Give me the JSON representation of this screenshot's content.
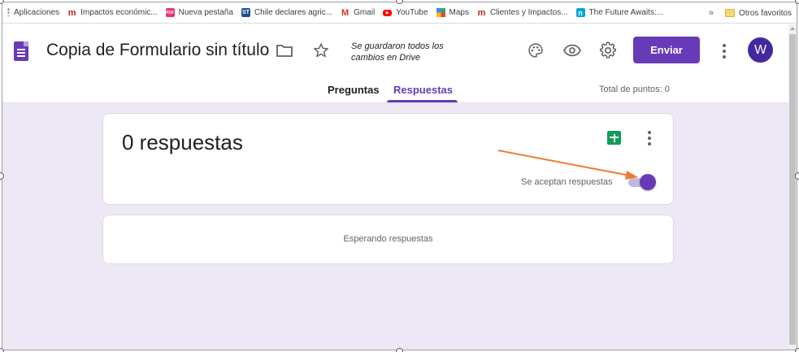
{
  "bookmarks": {
    "items": [
      {
        "label": "Aplicaciones",
        "icon": "apps-grid-icon"
      },
      {
        "label": "Impactos económic...",
        "icon": "m-logo-icon"
      },
      {
        "label": "Nueva pestaña",
        "icon": "pdf-icon"
      },
      {
        "label": "Chile declares agric...",
        "icon": "st-logo-icon"
      },
      {
        "label": "Gmail",
        "icon": "gmail-icon"
      },
      {
        "label": "YouTube",
        "icon": "youtube-icon"
      },
      {
        "label": "Maps",
        "icon": "maps-icon"
      },
      {
        "label": "Clientes y Impactos...",
        "icon": "m-logo-icon"
      },
      {
        "label": "The Future Awaits:...",
        "icon": "n-logo-icon"
      }
    ],
    "overflow": "»",
    "other_label": "Otros favoritos"
  },
  "header": {
    "title": "Copia de Formulario sin título",
    "saved_status": "Se guardaron todos los cambios en Drive",
    "send_label": "Enviar",
    "avatar_initial": "W",
    "tabs": [
      {
        "label": "Preguntas",
        "active": false
      },
      {
        "label": "Respuestas",
        "active": true
      }
    ],
    "total_points": "Total de puntos: 0"
  },
  "responses": {
    "count_text": "0 respuestas",
    "accepting_label": "Se aceptan respuestas",
    "accepting": true,
    "waiting_text": "Esperando respuestas"
  },
  "colors": {
    "accent": "#673ab7",
    "background": "#ede7f6",
    "sheets": "#0f9d58",
    "annotation_arrow": "#ed7d31"
  }
}
